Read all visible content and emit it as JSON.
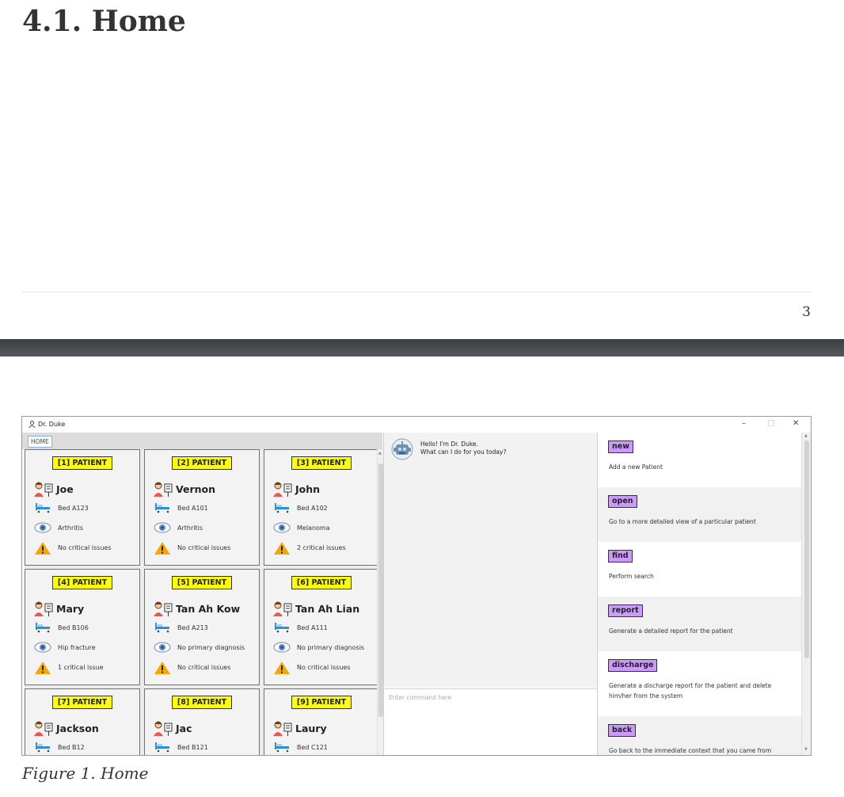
{
  "document": {
    "heading": "4.1. Home",
    "page_number": "3",
    "caption": "Figure 1. Home"
  },
  "window": {
    "title": "Dr. Duke",
    "minimize_glyph": "–",
    "maximize_glyph": "□",
    "close_glyph": "✕",
    "tab_label": "HOME"
  },
  "patients": [
    {
      "badge": "[1] PATIENT",
      "name": "Joe",
      "bed": "Bed A123",
      "diagnosis": "Arthritis",
      "issues": "No critical issues"
    },
    {
      "badge": "[2] PATIENT",
      "name": "Vernon",
      "bed": "Bed A101",
      "diagnosis": "Arthritis",
      "issues": "No critical issues"
    },
    {
      "badge": "[3] PATIENT",
      "name": "John",
      "bed": "Bed A102",
      "diagnosis": "Melanoma",
      "issues": "2 critical issues"
    },
    {
      "badge": "[4] PATIENT",
      "name": "Mary",
      "bed": "Bed B106",
      "diagnosis": "Hip fracture",
      "issues": "1 critical issue"
    },
    {
      "badge": "[5] PATIENT",
      "name": "Tan Ah Kow",
      "bed": "Bed A213",
      "diagnosis": "No primary diagnosis",
      "issues": "No critical issues"
    },
    {
      "badge": "[6] PATIENT",
      "name": "Tan Ah Lian",
      "bed": "Bed A111",
      "diagnosis": "No primary diagnosis",
      "issues": "No critical issues"
    },
    {
      "badge": "[7] PATIENT",
      "name": "Jackson",
      "bed": "Bed B12",
      "diagnosis": "",
      "issues": ""
    },
    {
      "badge": "[8] PATIENT",
      "name": "Jac",
      "bed": "Bed B121",
      "diagnosis": "",
      "issues": ""
    },
    {
      "badge": "[9] PATIENT",
      "name": "Laury",
      "bed": "Bed C121",
      "diagnosis": "",
      "issues": ""
    }
  ],
  "chat": {
    "greeting_line1": "Hello! I'm Dr. Duke.",
    "greeting_line2": "What can I do for you today?",
    "input_placeholder": "Enter command here",
    "input_value": ""
  },
  "commands": [
    {
      "name": "new",
      "description": "Add a new Patient"
    },
    {
      "name": "open",
      "description": "Go to a more detailed view of a particular patient"
    },
    {
      "name": "find",
      "description": "Perform search"
    },
    {
      "name": "report",
      "description": "Generate a detailed report for the patient"
    },
    {
      "name": "discharge",
      "description": "Generate a discharge report for the patient and delete him/her from the system"
    },
    {
      "name": "back",
      "description": "Go back to the immediate context that you came from"
    }
  ],
  "colors": {
    "patient_badge": "#ffff00",
    "command_chip": "#cc99ff",
    "page_separator": "#45494e"
  },
  "icons": {
    "patient": "doctor-patient-icon",
    "bed": "hospital-bed-icon",
    "diagnosis": "eye-icon",
    "issues": "warning-icon",
    "bot": "robot-avatar-icon"
  }
}
